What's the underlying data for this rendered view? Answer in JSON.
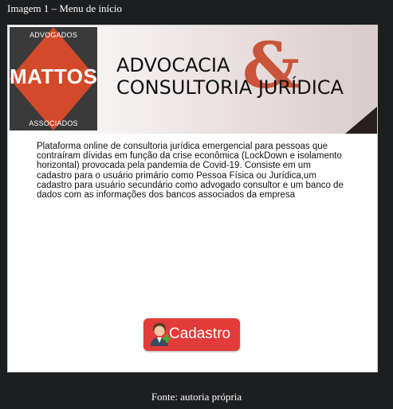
{
  "caption": "Imagem 1 – Menu de início",
  "banner": {
    "logo_top": "ADVOGADOS",
    "logo_main": "MATTOS",
    "logo_bottom": "ASSOCIADOS",
    "title_line1": "ADVOCACIA",
    "title_line2": "CONSULTORIA JURÍDICA",
    "ampersand": "&"
  },
  "description": "Plataforma online de consultoria jurídica emergencial para pessoas que contraíram dívidas em função da crise econômica (LockDown e isolamento horizontal) provocada pela pandemia de Covid-19. Consiste em um cadastro para o usuário primário como Pessoa Física ou Jurídica,um cadastro para usuário secundário como advogado consultor e um banco de dados com as informações dos bancos associados da empresa",
  "register_button": {
    "label": "Cadastro",
    "icon": "user-add-icon",
    "color": "#e23b39"
  },
  "footer": "Fonte: autoria própria",
  "colors": {
    "logo_orange": "#d24a2a",
    "logo_dark": "#3a3a3a",
    "ampersand": "#c9553a",
    "page_bg": "#1d1e20"
  }
}
